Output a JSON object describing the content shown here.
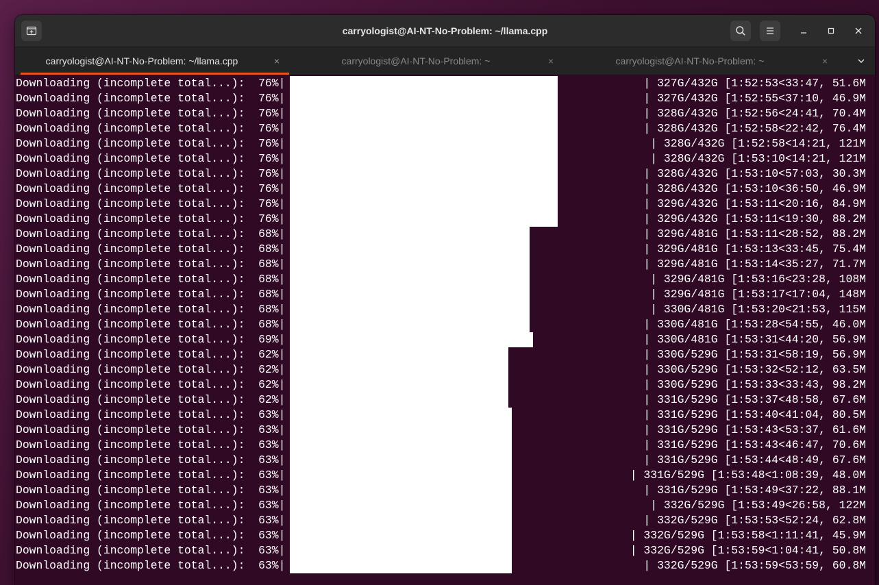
{
  "window": {
    "title": "carryologist@AI-NT-No-Problem: ~/llama.cpp"
  },
  "tabs": [
    {
      "label": "carryologist@AI-NT-No-Problem: ~/llama.cpp",
      "close": "×",
      "active": true
    },
    {
      "label": "carryologist@AI-NT-No-Problem: ~",
      "close": "×",
      "active": false
    },
    {
      "label": "carryologist@AI-NT-No-Problem: ~",
      "close": "×",
      "active": false
    }
  ],
  "icons": {
    "new_tab": "new-tab-icon",
    "search": "search-icon",
    "menu": "hamburger-menu-icon",
    "minimize": "minimize-icon",
    "maximize": "maximize-icon",
    "close": "close-icon",
    "tab_overflow": "chevron-down-icon"
  },
  "colors": {
    "terminal_bg": "#300a24",
    "accent": "#e95420",
    "headerbar": "#2c2c2c"
  },
  "terminal_lines": [
    {
      "prefix": "Downloading (incomplete total...):  76%|",
      "fill": 0.76,
      "suffix": "| 327G/432G [1:52:53<33:47, 51.6M"
    },
    {
      "prefix": "Downloading (incomplete total...):  76%|",
      "fill": 0.76,
      "suffix": "| 327G/432G [1:52:55<37:10, 46.9M"
    },
    {
      "prefix": "Downloading (incomplete total...):  76%|",
      "fill": 0.76,
      "suffix": "| 328G/432G [1:52:56<24:41, 70.4M"
    },
    {
      "prefix": "Downloading (incomplete total...):  76%|",
      "fill": 0.76,
      "suffix": "| 328G/432G [1:52:58<22:42, 76.4M"
    },
    {
      "prefix": "Downloading (incomplete total...):  76%|",
      "fill": 0.76,
      "suffix": "| 328G/432G [1:52:58<14:21, 121M"
    },
    {
      "prefix": "Downloading (incomplete total...):  76%|",
      "fill": 0.76,
      "suffix": "| 328G/432G [1:53:10<14:21, 121M"
    },
    {
      "prefix": "Downloading (incomplete total...):  76%|",
      "fill": 0.76,
      "suffix": "| 328G/432G [1:53:10<57:03, 30.3M"
    },
    {
      "prefix": "Downloading (incomplete total...):  76%|",
      "fill": 0.76,
      "suffix": "| 328G/432G [1:53:10<36:50, 46.9M"
    },
    {
      "prefix": "Downloading (incomplete total...):  76%|",
      "fill": 0.76,
      "suffix": "| 329G/432G [1:53:11<20:16, 84.9M"
    },
    {
      "prefix": "Downloading (incomplete total...):  76%|",
      "fill": 0.76,
      "suffix": "| 329G/432G [1:53:11<19:30, 88.2M"
    },
    {
      "prefix": "Downloading (incomplete total...):  68%|",
      "fill": 0.68,
      "suffix": "| 329G/481G [1:53:11<28:52, 88.2M"
    },
    {
      "prefix": "Downloading (incomplete total...):  68%|",
      "fill": 0.68,
      "suffix": "| 329G/481G [1:53:13<33:45, 75.4M"
    },
    {
      "prefix": "Downloading (incomplete total...):  68%|",
      "fill": 0.68,
      "suffix": "| 329G/481G [1:53:14<35:27, 71.7M"
    },
    {
      "prefix": "Downloading (incomplete total...):  68%|",
      "fill": 0.68,
      "suffix": "| 329G/481G [1:53:16<23:28, 108M"
    },
    {
      "prefix": "Downloading (incomplete total...):  68%|",
      "fill": 0.68,
      "suffix": "| 329G/481G [1:53:17<17:04, 148M"
    },
    {
      "prefix": "Downloading (incomplete total...):  68%|",
      "fill": 0.68,
      "suffix": "| 330G/481G [1:53:20<21:53, 115M"
    },
    {
      "prefix": "Downloading (incomplete total...):  68%|",
      "fill": 0.68,
      "suffix": "| 330G/481G [1:53:28<54:55, 46.0M"
    },
    {
      "prefix": "Downloading (incomplete total...):  69%|",
      "fill": 0.69,
      "suffix": "| 330G/481G [1:53:31<44:20, 56.9M"
    },
    {
      "prefix": "Downloading (incomplete total...):  62%|",
      "fill": 0.62,
      "suffix": "| 330G/529G [1:53:31<58:19, 56.9M"
    },
    {
      "prefix": "Downloading (incomplete total...):  62%|",
      "fill": 0.62,
      "suffix": "| 330G/529G [1:53:32<52:12, 63.5M"
    },
    {
      "prefix": "Downloading (incomplete total...):  62%|",
      "fill": 0.62,
      "suffix": "| 330G/529G [1:53:33<33:43, 98.2M"
    },
    {
      "prefix": "Downloading (incomplete total...):  62%|",
      "fill": 0.62,
      "suffix": "| 331G/529G [1:53:37<48:58, 67.6M"
    },
    {
      "prefix": "Downloading (incomplete total...):  63%|",
      "fill": 0.63,
      "suffix": "| 331G/529G [1:53:40<41:04, 80.5M"
    },
    {
      "prefix": "Downloading (incomplete total...):  63%|",
      "fill": 0.63,
      "suffix": "| 331G/529G [1:53:43<53:37, 61.6M"
    },
    {
      "prefix": "Downloading (incomplete total...):  63%|",
      "fill": 0.63,
      "suffix": "| 331G/529G [1:53:43<46:47, 70.6M"
    },
    {
      "prefix": "Downloading (incomplete total...):  63%|",
      "fill": 0.63,
      "suffix": "| 331G/529G [1:53:44<48:49, 67.6M"
    },
    {
      "prefix": "Downloading (incomplete total...):  63%|",
      "fill": 0.63,
      "suffix": "| 331G/529G [1:53:48<1:08:39, 48.0M"
    },
    {
      "prefix": "Downloading (incomplete total...):  63%|",
      "fill": 0.63,
      "suffix": "| 331G/529G [1:53:49<37:22, 88.1M"
    },
    {
      "prefix": "Downloading (incomplete total...):  63%|",
      "fill": 0.63,
      "suffix": "| 332G/529G [1:53:49<26:58, 122M"
    },
    {
      "prefix": "Downloading (incomplete total...):  63%|",
      "fill": 0.63,
      "suffix": "| 332G/529G [1:53:53<52:24, 62.8M"
    },
    {
      "prefix": "Downloading (incomplete total...):  63%|",
      "fill": 0.63,
      "suffix": "| 332G/529G [1:53:58<1:11:41, 45.9M"
    },
    {
      "prefix": "Downloading (incomplete total...):  63%|",
      "fill": 0.63,
      "suffix": "| 332G/529G [1:53:59<1:04:41, 50.8M"
    },
    {
      "prefix": "Downloading (incomplete total...):  63%|",
      "fill": 0.63,
      "suffix": "| 332G/529G [1:53:59<53:59, 60.8M"
    }
  ]
}
